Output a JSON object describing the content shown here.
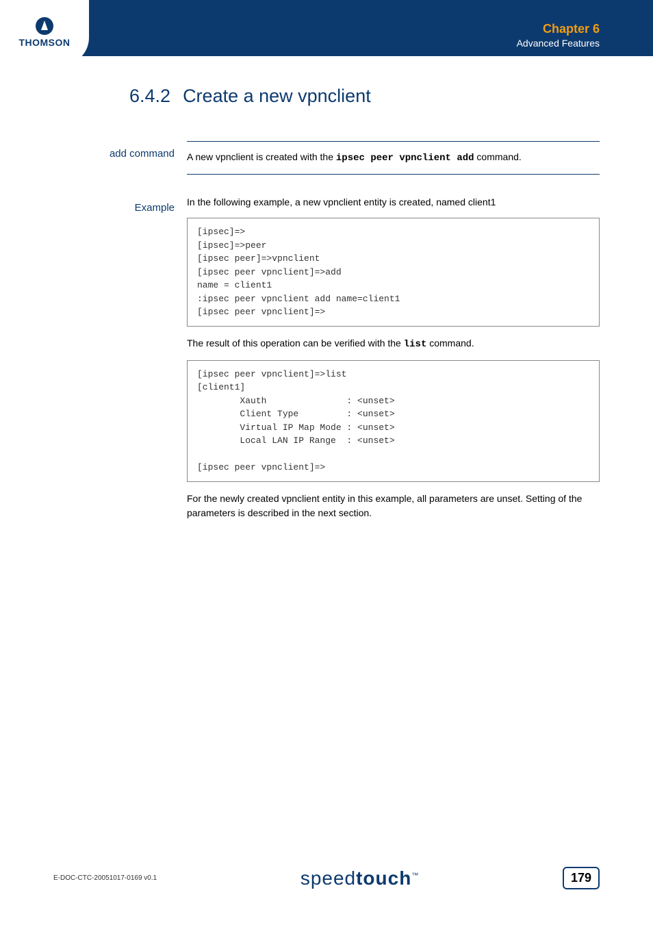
{
  "header": {
    "chapter": "Chapter 6",
    "subtitle": "Advanced Features"
  },
  "logo": {
    "brand": "THOMSON"
  },
  "section": {
    "number": "6.4.2",
    "title": "Create a new vpnclient"
  },
  "block1": {
    "label": "add command",
    "text_before": "A new vpnclient is created with the ",
    "command": "ipsec peer vpnclient add",
    "text_after": " command."
  },
  "block2": {
    "label": "Example",
    "intro": "In the following example, a new vpnclient entity is created, named client1",
    "code1": "[ipsec]=>\n[ipsec]=>peer\n[ipsec peer]=>vpnclient\n[ipsec peer vpnclient]=>add\nname = client1\n:ipsec peer vpnclient add name=client1\n[ipsec peer vpnclient]=>",
    "result_before": "The result of this operation can be verified with the ",
    "result_cmd": "list",
    "result_after": " command.",
    "code2": "[ipsec peer vpnclient]=>list\n[client1]\n        Xauth               : <unset>\n        Client Type         : <unset>\n        Virtual IP Map Mode : <unset>\n        Local LAN IP Range  : <unset>\n\n[ipsec peer vpnclient]=>",
    "closing": "For the newly created vpnclient entity in this example, all parameters are unset. Setting of the parameters is described in the next section."
  },
  "footer": {
    "doc_id": "E-DOC-CTC-20051017-0169 v0.1",
    "brand_light": "speed",
    "brand_bold": "touch",
    "tm": "™",
    "page": "179"
  }
}
